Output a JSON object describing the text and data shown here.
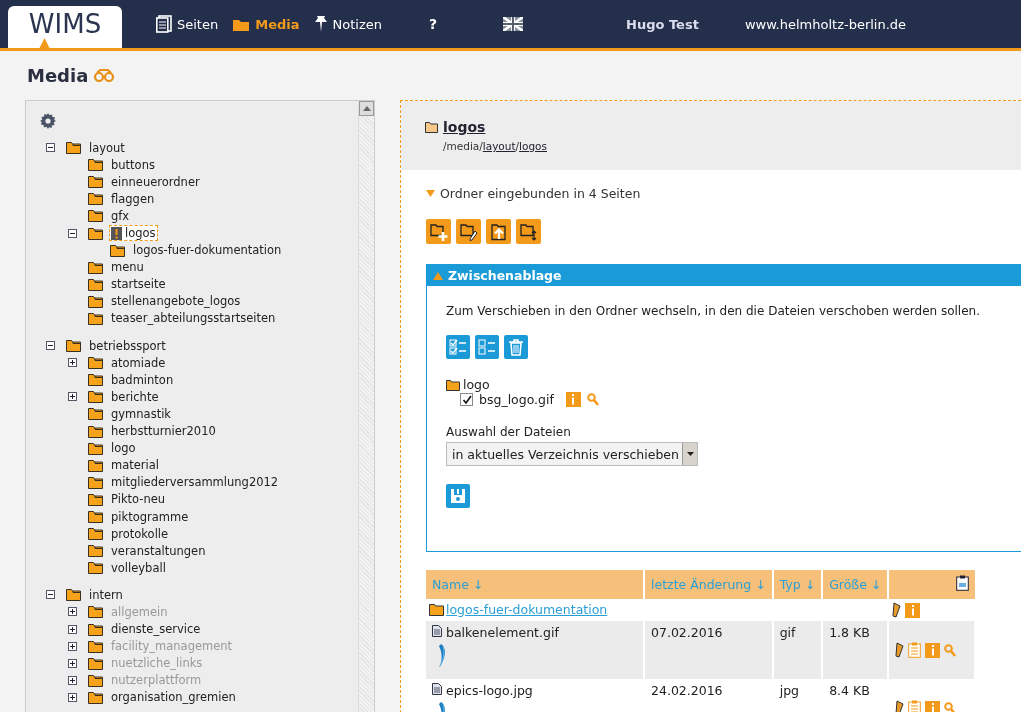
{
  "header": {
    "logo": "WIMS",
    "nav": [
      {
        "label": "Seiten",
        "selected": false
      },
      {
        "label": "Media",
        "selected": true
      },
      {
        "label": "Notizen",
        "selected": false
      }
    ],
    "help": "?",
    "user": "Hugo Test",
    "site": "www.helmholtz-berlin.de"
  },
  "page_title": "Media",
  "tree": [
    {
      "label": "layout",
      "expanded": true,
      "selected": false,
      "disabled": false,
      "children": [
        {
          "label": "buttons",
          "selected": false,
          "disabled": false
        },
        {
          "label": "einneuerordner",
          "selected": false,
          "disabled": false
        },
        {
          "label": "flaggen",
          "selected": false,
          "disabled": false
        },
        {
          "label": "gfx",
          "selected": false,
          "disabled": false
        },
        {
          "label": "logos",
          "expanded": true,
          "selected": true,
          "disabled": false,
          "children": [
            {
              "label": "logos-fuer-dokumentation",
              "selected": false,
              "disabled": false
            }
          ]
        },
        {
          "label": "menu",
          "selected": false,
          "disabled": false
        },
        {
          "label": "startseite",
          "selected": false,
          "disabled": false
        },
        {
          "label": "stellenangebote_logos",
          "selected": false,
          "disabled": false
        },
        {
          "label": "teaser_abteilungsstartseiten",
          "selected": false,
          "disabled": false
        }
      ]
    },
    {
      "label": "betriebssport",
      "expanded": true,
      "selected": false,
      "disabled": false,
      "children": [
        {
          "label": "atomiade",
          "expanded": false,
          "selected": false,
          "disabled": false
        },
        {
          "label": "badminton",
          "selected": false,
          "disabled": false
        },
        {
          "label": "berichte",
          "expanded": false,
          "selected": false,
          "disabled": false
        },
        {
          "label": "gymnastik",
          "selected": false,
          "disabled": false
        },
        {
          "label": "herbstturnier2010",
          "selected": false,
          "disabled": false
        },
        {
          "label": "logo",
          "selected": false,
          "disabled": false
        },
        {
          "label": "material",
          "selected": false,
          "disabled": false
        },
        {
          "label": "mitgliederversammlung2012",
          "selected": false,
          "disabled": false
        },
        {
          "label": "Pikto-neu",
          "selected": false,
          "disabled": false
        },
        {
          "label": "piktogramme",
          "selected": false,
          "disabled": false
        },
        {
          "label": "protokolle",
          "selected": false,
          "disabled": false
        },
        {
          "label": "veranstaltungen",
          "selected": false,
          "disabled": false
        },
        {
          "label": "volleyball",
          "selected": false,
          "disabled": false
        }
      ]
    },
    {
      "label": "intern",
      "expanded": true,
      "selected": false,
      "disabled": false,
      "children": [
        {
          "label": "allgemein",
          "expanded": false,
          "selected": false,
          "disabled": true
        },
        {
          "label": "dienste_service",
          "expanded": false,
          "selected": false,
          "disabled": false
        },
        {
          "label": "facility_management",
          "expanded": false,
          "selected": false,
          "disabled": true
        },
        {
          "label": "nuetzliche_links",
          "expanded": false,
          "selected": false,
          "disabled": true
        },
        {
          "label": "nutzerplattform",
          "expanded": false,
          "selected": false,
          "disabled": true
        },
        {
          "label": "organisation_gremien",
          "expanded": false,
          "selected": false,
          "disabled": false
        }
      ]
    }
  ],
  "folder": {
    "name": "logos",
    "path": [
      {
        "label": "/media/",
        "link": false
      },
      {
        "label": "layout",
        "link": true
      },
      {
        "label": "/",
        "link": false
      },
      {
        "label": "logos",
        "link": true
      }
    ],
    "usage": "Ordner eingebunden in 4 Seiten"
  },
  "clipboard": {
    "title": "Zwischenablage",
    "expanded": true,
    "hint": "Zum Verschieben in den Ordner wechseln, in den die Dateien verschoben werden sollen.",
    "folder": "logo",
    "files": [
      {
        "name": "bsg_logo.gif",
        "checked": true
      }
    ],
    "select_label": "Auswahl der Dateien",
    "select_value": "in aktuelles Verzeichnis verschieben"
  },
  "table": {
    "columns": [
      "Name ↓",
      "letzte Änderung ↓",
      "Typ ↓",
      "Größe ↓"
    ],
    "rows": [
      {
        "kind": "folder",
        "name": "logos-fuer-dokumentation"
      },
      {
        "kind": "file",
        "name": "balkenelement.gif",
        "date": "07.02.2016",
        "type": "gif",
        "size": "1.8 KB"
      },
      {
        "kind": "file",
        "name": "epics-logo.jpg",
        "date": "24.02.2016",
        "type": "jpg",
        "size": "8.4 KB"
      }
    ]
  }
}
